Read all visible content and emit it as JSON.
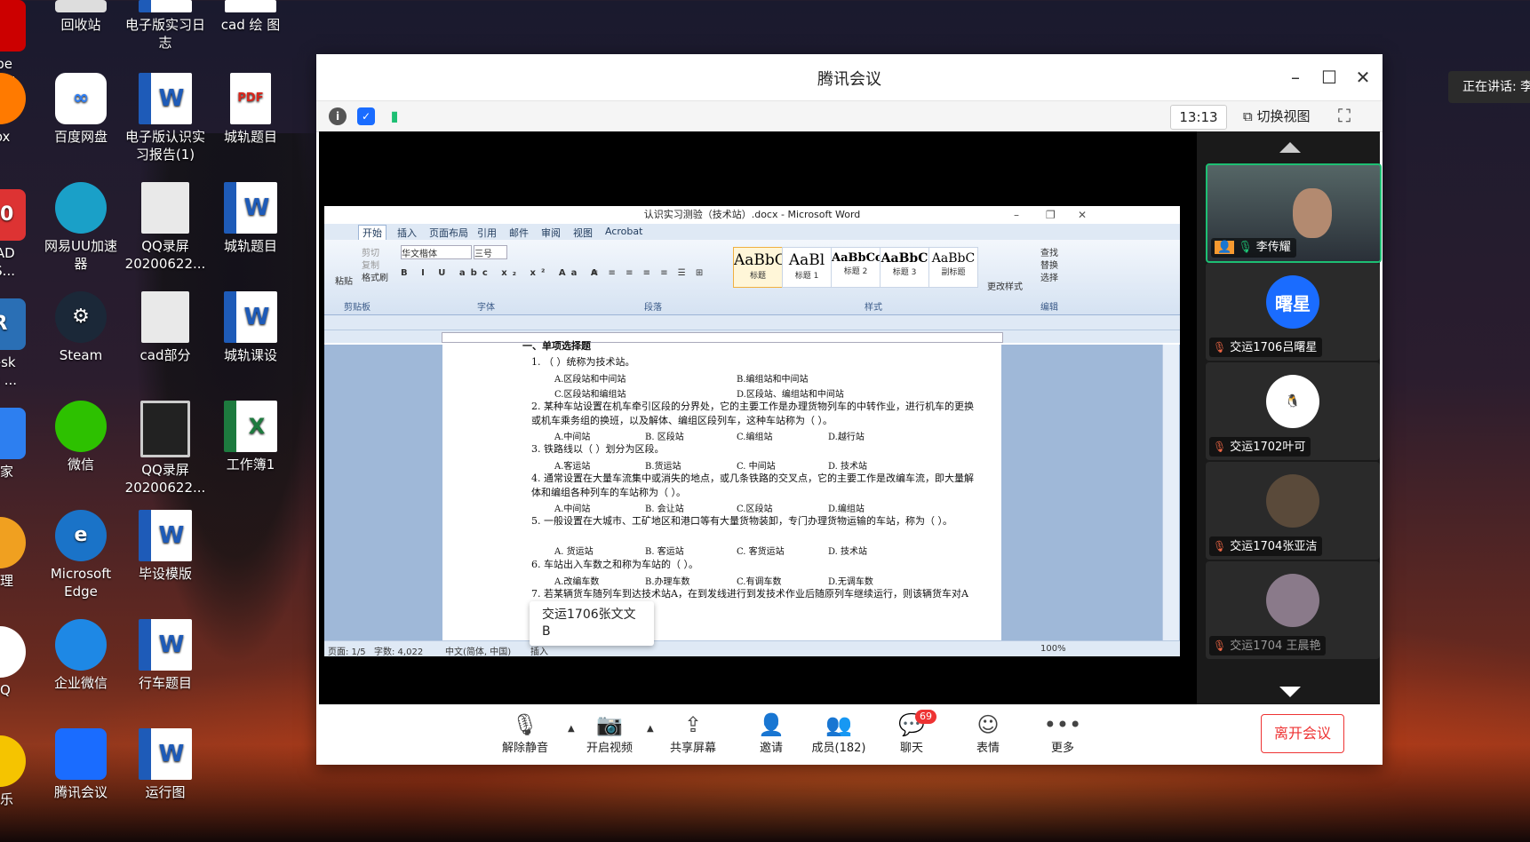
{
  "desktop": {
    "col0": [
      "obe\ner XI",
      "fox",
      "GAD\n- S...",
      "desk\ngn ...",
      "管家",
      "管理",
      "QQ",
      "音乐"
    ],
    "col1": [
      "回收站",
      "百度网盘",
      "网易UU加速\n器",
      "Steam",
      "微信",
      "Microsoft\nEdge",
      "企业微信",
      "腾讯会议"
    ],
    "col2": [
      "电子版实习日\n志",
      "电子版认识实\n习报告(1)",
      "QQ录屏\n20200622...",
      "cad部分",
      "QQ录屏\n20200622...",
      "毕设模版",
      "行车题目",
      "运行图"
    ],
    "col3": [
      "cad 绘 图",
      "城轨题目",
      "城轨题目",
      "城轨课设",
      "工作簿1"
    ]
  },
  "speaking_banner": "正在讲话: 李",
  "meeting": {
    "title": "腾讯会议",
    "time": "13:13",
    "switch_view": "切换视图",
    "tooltip": "交运1706张文文\nB",
    "chat_badge": "69",
    "buttons": {
      "unmute": "解除静音",
      "video": "开启视频",
      "share": "共享屏幕",
      "invite": "邀请",
      "members": "成员(182)",
      "chat": "聊天",
      "reaction": "表情",
      "more": "更多",
      "leave": "离开会议"
    },
    "participants": [
      {
        "name": "李传耀",
        "avatar_text": "",
        "color": "#556"
      },
      {
        "name": "交运1706吕曙星",
        "avatar_text": "曙星",
        "color": "#1a6cff"
      },
      {
        "name": "交运1702叶可",
        "avatar_text": "QQ",
        "color": "#fff"
      },
      {
        "name": "交运1704张亚洁",
        "avatar_text": "",
        "color": "#5a4a3a"
      },
      {
        "name": "交运1704 王晨艳",
        "avatar_text": "",
        "color": "#8a7a8a"
      }
    ]
  },
  "word": {
    "title": "认识实习测验（技术站）.docx - Microsoft Word",
    "tabs": [
      "开始",
      "插入",
      "页面布局",
      "引用",
      "邮件",
      "审阅",
      "视图",
      "Acrobat"
    ],
    "font_name": "华文楷体",
    "font_size": "三号",
    "clipboard": {
      "paste": "粘贴",
      "cut": "剪切",
      "copy": "复制",
      "format": "格式刷"
    },
    "groups": [
      "剪贴板",
      "字体",
      "段落",
      "样式",
      "编辑"
    ],
    "styles": [
      {
        "sample": "AaBbC",
        "label": "标题"
      },
      {
        "sample": "AaBl",
        "label": "标题 1"
      },
      {
        "sample": "AaBbCc",
        "label": "标题 2"
      },
      {
        "sample": "AaBbC",
        "label": "标题 3"
      },
      {
        "sample": "AaBbC",
        "label": "副标题"
      }
    ],
    "change_styles": "更改样式",
    "editing": [
      "查找",
      "替换",
      "选择"
    ],
    "section_heading": "一、单项选择题",
    "questions": [
      {
        "num": "1.",
        "text": "（    ）统称为技术站。",
        "options": [
          "A.区段站和中间站",
          "B.编组站和中间站",
          "C.区段站和编组站",
          "D.区段站、编组站和中间站"
        ]
      },
      {
        "num": "2.",
        "text": "某种车站设置在机车牵引区段的分界处，它的主要工作是办理货物列车的中转作业，进行机车的更换或机车乘务组的换班，以及解体、编组区段列车，这种车站称为（  ）。",
        "options": [
          "A.中间站",
          "B. 区段站",
          "C.编组站",
          "D.越行站"
        ]
      },
      {
        "num": "3.",
        "text": "铁路线以（    ）划分为区段。",
        "options": [
          "A.客运站",
          "B.货运站",
          "C. 中间站",
          "D. 技术站"
        ]
      },
      {
        "num": "4.",
        "text": "通常设置在大量车流集中或消失的地点，或几条铁路的交叉点，它的主要工作是改编车流，即大量解体和编组各种列车的车站称为（  ）。",
        "options": [
          "A.中间站",
          "B. 会让站",
          "C.区段站",
          "D.编组站"
        ]
      },
      {
        "num": "5.",
        "text": "一般设置在大城市、工矿地区和港口等有大量货物装卸，专门办理货物运输的车站，称为（  ）。",
        "options": [
          "A. 货运站",
          "B. 客运站",
          "C. 客货运站",
          "D. 技术站"
        ]
      },
      {
        "num": "6.",
        "text": "车站出入车数之和称为车站的（    ）。",
        "options": [
          "A.改编车数",
          "B.办理车数",
          "C.有调车数",
          "D.无调车数"
        ]
      },
      {
        "num": "7.",
        "text": "若某辆货车随列车到达技术站A，在到发线进行到发技术作业后随原列车继续运行，则该辆货车对A站来说属于（  ）车。",
        "options": []
      }
    ],
    "status": {
      "page": "页面: 1/5",
      "words": "字数: 4,022",
      "lang": "中文(简体, 中国)",
      "mode": "插入",
      "zoom": "100%"
    }
  },
  "colors": {
    "leave": "#e33333",
    "active_tile": "#1dbf73",
    "word_blue": "#1e5bb8"
  }
}
